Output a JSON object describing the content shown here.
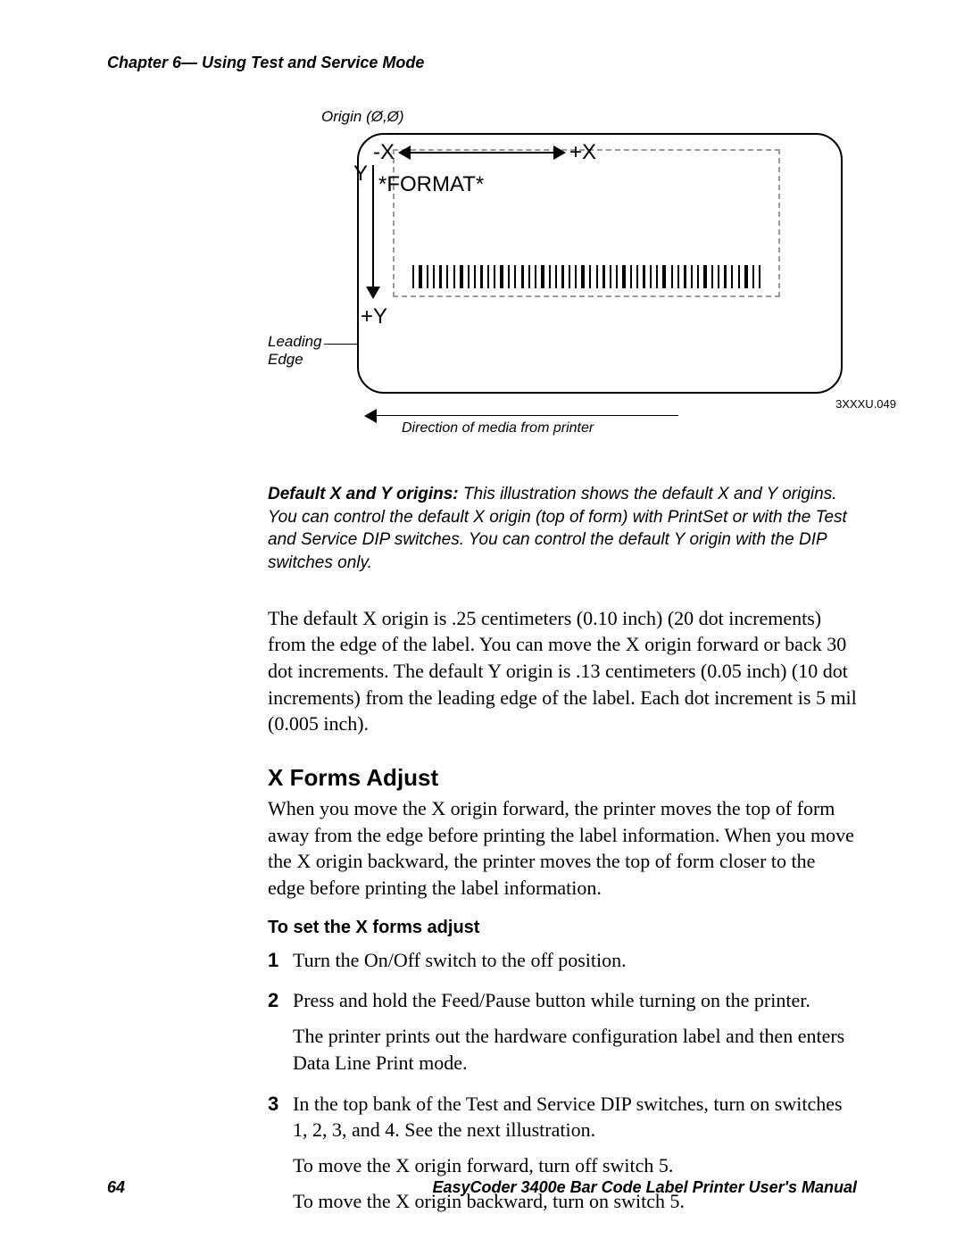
{
  "chapter_header": "Chapter 6— Using Test and Service Mode",
  "diagram": {
    "origin_label": "Origin (Ø,Ø)",
    "format_text": "*FORMAT*",
    "minus_x": "-X",
    "plus_x": "+X",
    "y_label": "Y",
    "plus_y": "+Y",
    "leading_edge": "Leading\nEdge",
    "drawing_number": "3XXXU.049",
    "direction_label": "Direction of media from printer"
  },
  "caption": {
    "lead": "Default X and Y origins:",
    "text": " This illustration shows the default X and Y origins. You can control the default X origin (top of form) with PrintSet or with the Test and Service DIP switches. You can control the default Y origin with the DIP switches only."
  },
  "para_default_origins": "The default X origin is .25 centimeters (0.10 inch) (20 dot increments) from the edge of the label. You can move the X origin forward or back 30 dot increments. The default Y origin is .13 centimeters (0.05 inch) (10 dot increments) from the leading edge of the label. Each dot increment is 5 mil (0.005 inch).",
  "section_heading": "X Forms Adjust",
  "para_x_forms": "When you move the X origin forward, the printer moves the top of form away from the edge before printing the label information. When you move the X origin backward, the printer moves the top of form closer to the edge before printing the label information.",
  "sub_heading": "To set the X forms adjust",
  "steps": {
    "s1": "Turn the On/Off switch to the off position.",
    "s2_main": "Press and hold the Feed/Pause button while turning on the printer.",
    "s2_sub": "The printer prints out the hardware configuration label and then enters Data Line Print mode.",
    "s3_main": "In the top bank of the Test and Service DIP switches, turn on switches 1, 2, 3, and 4. See the next illustration.",
    "s3_sub1": "To move the X origin forward, turn off switch 5.",
    "s3_sub2": "To move the X origin backward, turn on switch 5."
  },
  "footer": {
    "page_number": "64",
    "manual_title": "EasyCoder 3400e Bar Code Label Printer User's Manual"
  }
}
